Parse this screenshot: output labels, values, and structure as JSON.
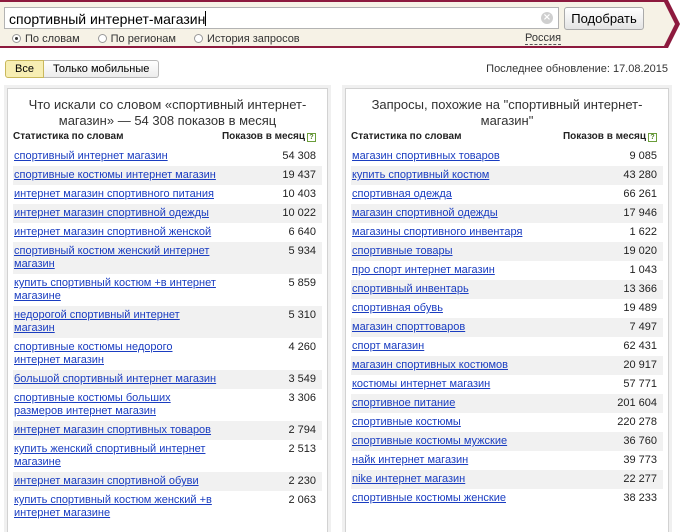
{
  "search": {
    "query": "спортивный интернет-магазин",
    "clear_icon": "clear-icon",
    "button_label": "Подобрать",
    "options": [
      {
        "label": "По словам",
        "selected": true
      },
      {
        "label": "По регионам",
        "selected": false
      },
      {
        "label": "История запросов",
        "selected": false
      }
    ],
    "region": "Россия"
  },
  "filters": {
    "all_label": "Все",
    "mobile_label": "Только мобильные",
    "last_update": "Последнее обновление: 17.08.2015"
  },
  "colors": {
    "band": "#8d1a3e",
    "band_fill": "#f6f2e6",
    "link": "#1a3dc1",
    "active_filter": "#f7eeb3"
  },
  "left": {
    "title": "Что искали со словом «спортивный интернет-магазин» — 54 308 показов в месяц",
    "col1": "Статистика по словам",
    "col2": "Показов в месяц",
    "help": "?",
    "rows": [
      {
        "q": "спортивный интернет магазин",
        "n": "54 308"
      },
      {
        "q": "спортивные костюмы интернет магазин",
        "n": "19 437"
      },
      {
        "q": "интернет магазин спортивного питания",
        "n": "10 403"
      },
      {
        "q": "интернет магазин спортивной одежды",
        "n": "10 022"
      },
      {
        "q": "интернет магазин спортивной женской",
        "n": "6 640"
      },
      {
        "q": "спортивный костюм женский интернет магазин",
        "n": "5 934"
      },
      {
        "q": "купить спортивный костюм +в интернет магазине",
        "n": "5 859"
      },
      {
        "q": "недорогой спортивный интернет магазин",
        "n": "5 310"
      },
      {
        "q": "спортивные костюмы недорого интернет магазин",
        "n": "4 260"
      },
      {
        "q": "большой спортивный интернет магазин",
        "n": "3 549"
      },
      {
        "q": "спортивные костюмы больших размеров интернет магазин",
        "n": "3 306"
      },
      {
        "q": "интернет магазин спортивных товаров",
        "n": "2 794"
      },
      {
        "q": "купить женский спортивный интернет магазине",
        "n": "2 513"
      },
      {
        "q": "интернет магазин спортивной обуви",
        "n": "2 230"
      },
      {
        "q": "купить спортивный костюм женский +в интернет магазине",
        "n": "2 063"
      }
    ]
  },
  "right": {
    "title": "Запросы, похожие на \"спортивный интернет-магазин\"",
    "col1": "Статистика по словам",
    "col2": "Показов в месяц",
    "help": "?",
    "rows": [
      {
        "q": "магазин спортивных товаров",
        "n": "9 085"
      },
      {
        "q": "купить спортивный костюм",
        "n": "43 280"
      },
      {
        "q": "спортивная одежда",
        "n": "66 261"
      },
      {
        "q": "магазин спортивной одежды",
        "n": "17 946"
      },
      {
        "q": "магазины спортивного инвентаря",
        "n": "1 622"
      },
      {
        "q": "спортивные товары",
        "n": "19 020"
      },
      {
        "q": "про спорт интернет магазин",
        "n": "1 043"
      },
      {
        "q": "спортивный инвентарь",
        "n": "13 366"
      },
      {
        "q": "спортивная обувь",
        "n": "19 489"
      },
      {
        "q": "магазин спорттоваров",
        "n": "7 497"
      },
      {
        "q": "спорт магазин",
        "n": "62 431"
      },
      {
        "q": "магазин спортивных костюмов",
        "n": "20 917"
      },
      {
        "q": "костюмы интернет магазин",
        "n": "57 771"
      },
      {
        "q": "спортивное питание",
        "n": "201 604"
      },
      {
        "q": "спортивные костюмы",
        "n": "220 278"
      },
      {
        "q": "спортивные костюмы мужские",
        "n": "36 760"
      },
      {
        "q": "найк интернет магазин",
        "n": "39 773"
      },
      {
        "q": "nike интернет магазин",
        "n": "22 277"
      },
      {
        "q": "спортивные костюмы женские",
        "n": "38 233"
      }
    ]
  }
}
